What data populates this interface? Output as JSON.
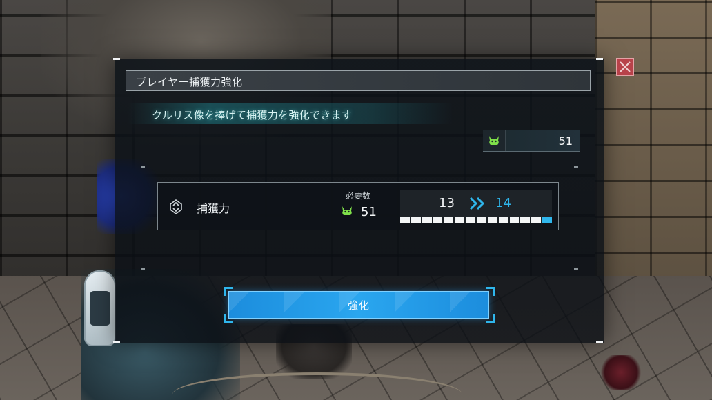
{
  "panel": {
    "title": "プレイヤー捕獲力強化",
    "subtitle": "クルリス像を捧げて捕獲力を強化できます",
    "inventory": {
      "icon": "kururis-statue-icon",
      "count": "51"
    }
  },
  "stat": {
    "icon": "capture-power-icon",
    "name": "捕獲力",
    "required_label": "必要数",
    "required_icon": "kururis-statue-icon",
    "required_value": "51",
    "current_level": "13",
    "next_level": "14",
    "progress": {
      "filled_segments": 13,
      "total_segments": 14
    }
  },
  "enhance_button": {
    "label": "強化"
  },
  "colors": {
    "accent_blue": "#2fb6ec",
    "button_blue": "#2aa6ef",
    "close_red": "#b8424a",
    "icon_green": "#7fe04a"
  }
}
